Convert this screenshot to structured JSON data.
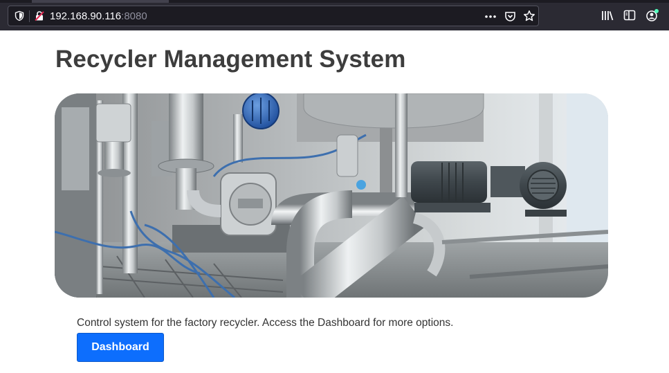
{
  "browser": {
    "url_host": "192.168.90.116",
    "url_port": ":8080",
    "icons": [
      "shield-icon",
      "insecure-lock-icon",
      "more-icon",
      "pocket-icon",
      "bookmark-star-icon",
      "library-icon",
      "sidebar-icon",
      "account-icon"
    ],
    "account_badge_color": "#54ffbd"
  },
  "page": {
    "title": "Recycler Management System",
    "description": "Control system for the factory recycler. Access the Dashboard for more options.",
    "dashboard_button": "Dashboard",
    "hero_image": "industrial machinery photo",
    "accent_color": "#0d6efd"
  }
}
